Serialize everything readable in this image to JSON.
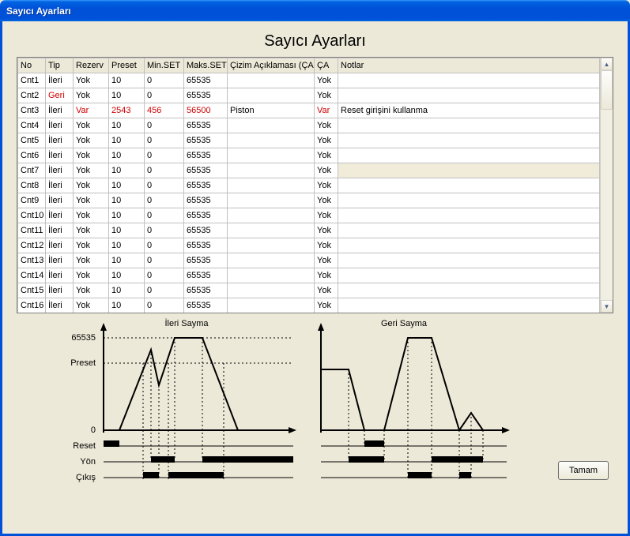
{
  "window_title": "Sayıcı Ayarları",
  "page_title": "Sayıcı Ayarları",
  "table": {
    "headers": [
      "No",
      "Tip",
      "Rezerv",
      "Preset",
      "Min.SET",
      "Maks.SET",
      "Çizim Açıklaması (ÇA)",
      "ÇA",
      "Notlar"
    ],
    "rows": [
      {
        "no": "Cnt1",
        "tip": "İleri",
        "rezerv": "Yok",
        "preset": "10",
        "min": "0",
        "maks": "65535",
        "ciz": "",
        "ca": "Yok",
        "not": ""
      },
      {
        "no": "Cnt2",
        "tip": "Geri",
        "tip_red": true,
        "rezerv": "Yok",
        "preset": "10",
        "min": "0",
        "maks": "65535",
        "ciz": "",
        "ca": "Yok",
        "not": ""
      },
      {
        "no": "Cnt3",
        "tip": "İleri",
        "rezerv": "Var",
        "rezerv_red": true,
        "preset": "2543",
        "preset_red": true,
        "min": "456",
        "min_red": true,
        "maks": "56500",
        "maks_red": true,
        "ciz": "Piston",
        "ca": "Var",
        "ca_red": true,
        "not": "Reset girişini kullanma"
      },
      {
        "no": "Cnt4",
        "tip": "İleri",
        "rezerv": "Yok",
        "preset": "10",
        "min": "0",
        "maks": "65535",
        "ciz": "",
        "ca": "Yok",
        "not": ""
      },
      {
        "no": "Cnt5",
        "tip": "İleri",
        "rezerv": "Yok",
        "preset": "10",
        "min": "0",
        "maks": "65535",
        "ciz": "",
        "ca": "Yok",
        "not": ""
      },
      {
        "no": "Cnt6",
        "tip": "İleri",
        "rezerv": "Yok",
        "preset": "10",
        "min": "0",
        "maks": "65535",
        "ciz": "",
        "ca": "Yok",
        "not": ""
      },
      {
        "no": "Cnt7",
        "tip": "İleri",
        "rezerv": "Yok",
        "preset": "10",
        "min": "0",
        "maks": "65535",
        "ciz": "",
        "ca": "Yok",
        "not": "",
        "selected": true
      },
      {
        "no": "Cnt8",
        "tip": "İleri",
        "rezerv": "Yok",
        "preset": "10",
        "min": "0",
        "maks": "65535",
        "ciz": "",
        "ca": "Yok",
        "not": ""
      },
      {
        "no": "Cnt9",
        "tip": "İleri",
        "rezerv": "Yok",
        "preset": "10",
        "min": "0",
        "maks": "65535",
        "ciz": "",
        "ca": "Yok",
        "not": ""
      },
      {
        "no": "Cnt10",
        "tip": "İleri",
        "rezerv": "Yok",
        "preset": "10",
        "min": "0",
        "maks": "65535",
        "ciz": "",
        "ca": "Yok",
        "not": ""
      },
      {
        "no": "Cnt11",
        "tip": "İleri",
        "rezerv": "Yok",
        "preset": "10",
        "min": "0",
        "maks": "65535",
        "ciz": "",
        "ca": "Yok",
        "not": ""
      },
      {
        "no": "Cnt12",
        "tip": "İleri",
        "rezerv": "Yok",
        "preset": "10",
        "min": "0",
        "maks": "65535",
        "ciz": "",
        "ca": "Yok",
        "not": ""
      },
      {
        "no": "Cnt13",
        "tip": "İleri",
        "rezerv": "Yok",
        "preset": "10",
        "min": "0",
        "maks": "65535",
        "ciz": "",
        "ca": "Yok",
        "not": ""
      },
      {
        "no": "Cnt14",
        "tip": "İleri",
        "rezerv": "Yok",
        "preset": "10",
        "min": "0",
        "maks": "65535",
        "ciz": "",
        "ca": "Yok",
        "not": ""
      },
      {
        "no": "Cnt15",
        "tip": "İleri",
        "rezerv": "Yok",
        "preset": "10",
        "min": "0",
        "maks": "65535",
        "ciz": "",
        "ca": "Yok",
        "not": ""
      },
      {
        "no": "Cnt16",
        "tip": "İleri",
        "rezerv": "Yok",
        "preset": "10",
        "min": "0",
        "maks": "65535",
        "ciz": "",
        "ca": "Yok",
        "not": ""
      }
    ]
  },
  "diagram": {
    "title_left": "İleri Sayma",
    "title_right": "Geri Sayma",
    "y_max": "65535",
    "y_preset": "Preset",
    "y_zero": "0",
    "row_reset": "Reset",
    "row_yon": "Yön",
    "row_cikis": "Çıkış"
  },
  "ok_button": "Tamam"
}
